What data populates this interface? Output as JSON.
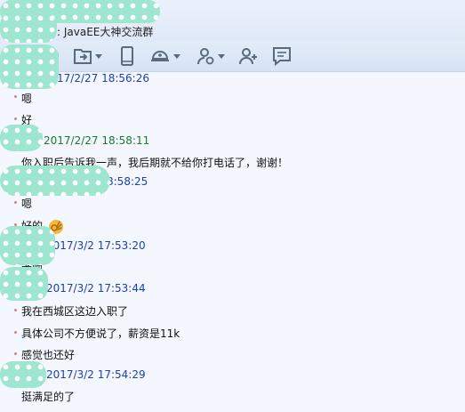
{
  "window": {
    "title_prefix": ":",
    "group_name": "JavaEE大神交流群"
  },
  "toolbar": {
    "icons": [
      "microphone-icon",
      "video-call-icon",
      "send-file-icon",
      "phone-device-icon",
      "remote-assist-icon",
      "add-member-icon",
      "invite-icon",
      "chat-history-icon"
    ]
  },
  "chat": {
    "entries": [
      {
        "kind": "timestamp",
        "text": "17/2/27 18:56:26",
        "color": "#1a3fb8"
      },
      {
        "kind": "message",
        "text": "嗯"
      },
      {
        "kind": "message",
        "text": "好"
      },
      {
        "kind": "timestamp",
        "text": "2017/2/27 18:58:11",
        "color": "#1c7a2c"
      },
      {
        "kind": "message",
        "text": "你入职后告诉我一声，我后期就不给你打电话了，谢谢！"
      },
      {
        "kind": "timestamp",
        "text": "8:58:25",
        "color": "#1a3fb8"
      },
      {
        "kind": "message",
        "text": "嗯"
      },
      {
        "kind": "message",
        "text": "好的"
      },
      {
        "kind": "timestamp",
        "text": "2017/3/2 17:53:20",
        "color": "#1a3fb8"
      },
      {
        "kind": "message",
        "text": "老师"
      },
      {
        "kind": "timestamp",
        "text": "2017/3/2 17:53:44",
        "color": "#1a3fb8"
      },
      {
        "kind": "message",
        "text": "我在西城区这边入职了"
      },
      {
        "kind": "message",
        "text": "具体公司不方便说了，薪资是11k"
      },
      {
        "kind": "message",
        "text": "感觉也还好"
      },
      {
        "kind": "timestamp",
        "text": "2017/3/2 17:54:29",
        "color": "#1a3fb8"
      },
      {
        "kind": "message",
        "text": "挺满足的了"
      }
    ]
  }
}
